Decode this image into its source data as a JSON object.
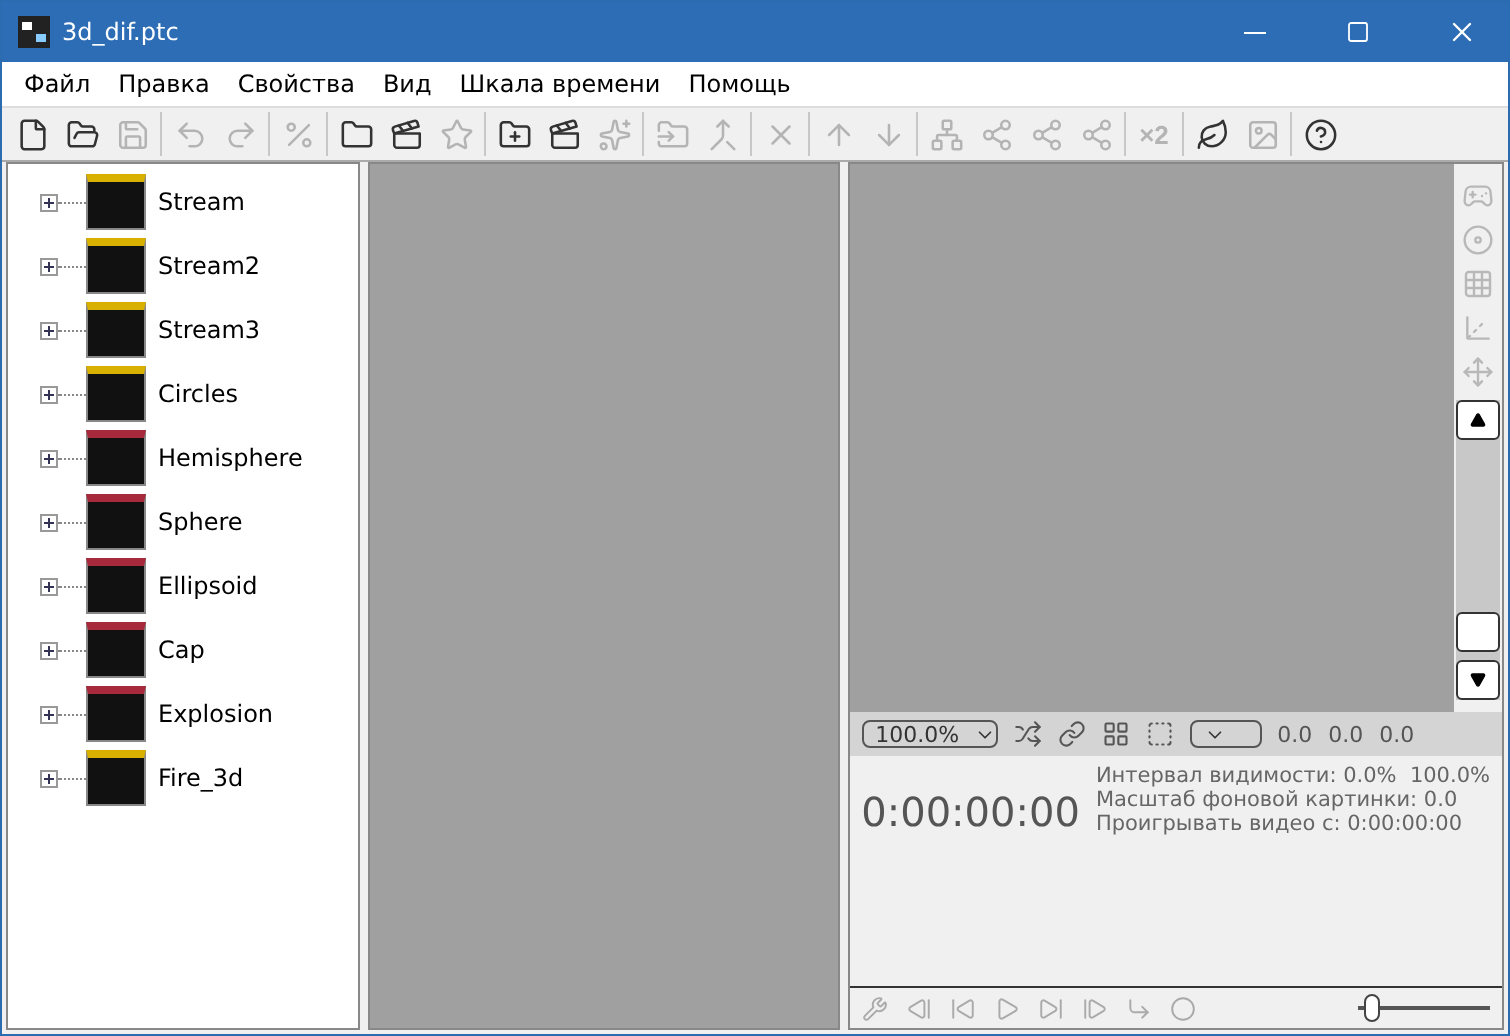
{
  "window": {
    "title": "3d_dif.ptc"
  },
  "menu": [
    "Файл",
    "Правка",
    "Свойства",
    "Вид",
    "Шкала времени",
    "Помощь"
  ],
  "toolbar": [
    {
      "kind": "button",
      "disabled": false
    },
    {
      "kind": "button",
      "disabled": false
    },
    {
      "kind": "button",
      "disabled": true
    },
    {
      "kind": "separator"
    },
    {
      "kind": "button",
      "disabled": true
    },
    {
      "kind": "button",
      "disabled": true
    },
    {
      "kind": "separator"
    },
    {
      "kind": "button",
      "disabled": true
    },
    {
      "kind": "separator"
    },
    {
      "kind": "button",
      "disabled": false
    },
    {
      "kind": "button",
      "disabled": false
    },
    {
      "kind": "button",
      "disabled": true
    },
    {
      "kind": "separator"
    },
    {
      "kind": "button",
      "disabled": false
    },
    {
      "kind": "button",
      "disabled": false
    },
    {
      "kind": "button",
      "disabled": true
    },
    {
      "kind": "separator"
    },
    {
      "kind": "button",
      "disabled": true
    },
    {
      "kind": "button",
      "disabled": true
    },
    {
      "kind": "separator"
    },
    {
      "kind": "button",
      "disabled": true
    },
    {
      "kind": "separator"
    },
    {
      "kind": "button",
      "disabled": true
    },
    {
      "kind": "button",
      "disabled": true
    },
    {
      "kind": "separator"
    },
    {
      "kind": "button",
      "disabled": true
    },
    {
      "kind": "button",
      "disabled": true
    },
    {
      "kind": "button",
      "disabled": true
    },
    {
      "kind": "button",
      "disabled": true
    },
    {
      "kind": "separator"
    },
    {
      "kind": "text",
      "label": "×2",
      "disabled": true
    },
    {
      "kind": "separator"
    },
    {
      "kind": "button",
      "disabled": false
    },
    {
      "kind": "button",
      "disabled": true
    },
    {
      "kind": "separator"
    },
    {
      "kind": "button",
      "disabled": false
    }
  ],
  "tree": [
    {
      "name": "Stream",
      "color": "#d8b000"
    },
    {
      "name": "Stream2",
      "color": "#d8b000"
    },
    {
      "name": "Stream3",
      "color": "#d8b000"
    },
    {
      "name": "Circles",
      "color": "#d8b000"
    },
    {
      "name": "Hemisphere",
      "color": "#a8283c"
    },
    {
      "name": "Sphere",
      "color": "#a8283c"
    },
    {
      "name": "Ellipsoid",
      "color": "#a8283c"
    },
    {
      "name": "Cap",
      "color": "#a8283c"
    },
    {
      "name": "Explosion",
      "color": "#a8283c"
    },
    {
      "name": "Fire_3d",
      "color": "#d8b000"
    }
  ],
  "viewport_bar": {
    "zoom": "100.0%",
    "readings": [
      "0.0",
      "0.0",
      "0.0"
    ]
  },
  "info": {
    "time": "0:00:00:00",
    "lines": [
      "Интервал видимости: 0.0%  100.0%",
      "Масштаб фоновой картинки: 0.0",
      "Проигрывать видео с: 0:00:00:00"
    ]
  },
  "playback": {
    "level": 0.05
  }
}
